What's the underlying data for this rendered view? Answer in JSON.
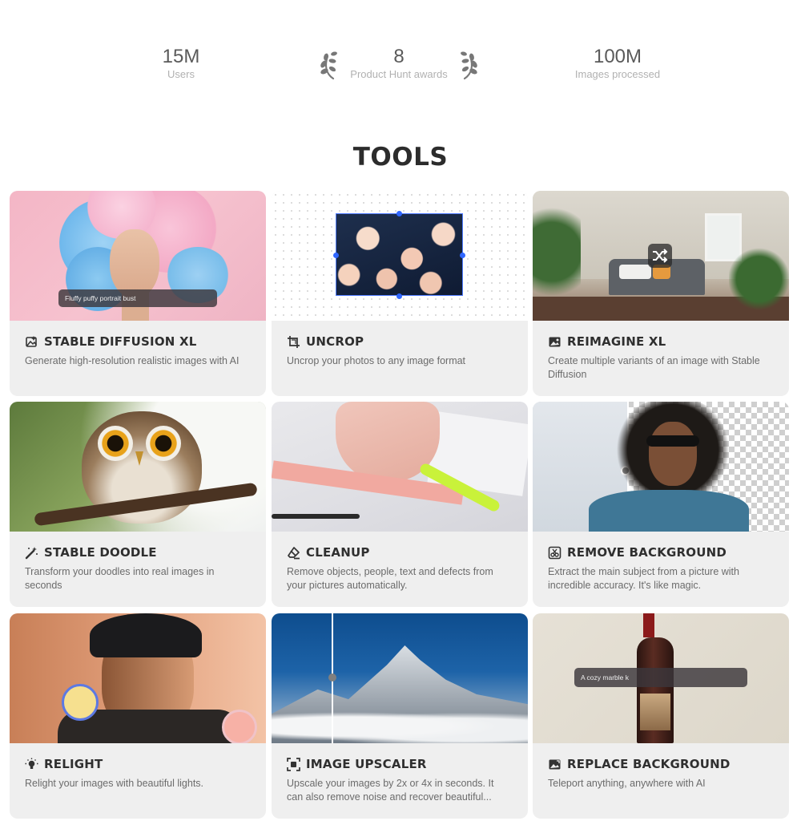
{
  "stats": {
    "users": {
      "value": "15M",
      "label": "Users"
    },
    "awards": {
      "value": "8",
      "label": "Product Hunt awards"
    },
    "images": {
      "value": "100M",
      "label": "Images processed"
    }
  },
  "section_title": "TOOLS",
  "tools": [
    {
      "title": "STABLE DIFFUSION XL",
      "desc": "Generate high-resolution realistic images with AI",
      "icon": "image-magic-icon",
      "prompt": "Fluffy puffy portrait bust"
    },
    {
      "title": "UNCROP",
      "desc": "Uncrop your photos to any image format",
      "icon": "crop-icon"
    },
    {
      "title": "REIMAGINE XL",
      "desc": "Create multiple variants of an image with Stable Diffusion",
      "icon": "image-sparkle-icon"
    },
    {
      "title": "STABLE DOODLE",
      "desc": "Transform your doodles into real images in seconds",
      "icon": "magic-wand-icon"
    },
    {
      "title": "CLEANUP",
      "desc": "Remove objects, people, text and defects from your pictures automatically.",
      "icon": "eraser-icon"
    },
    {
      "title": "REMOVE BACKGROUND",
      "desc": "Extract the main subject from a picture with incredible accuracy. It's like magic.",
      "icon": "cut-icon"
    },
    {
      "title": "RELIGHT",
      "desc": "Relight your images with beautiful lights.",
      "icon": "bulb-icon"
    },
    {
      "title": "IMAGE UPSCALER",
      "desc": "Upscale your images by 2x or 4x in seconds. It can also remove noise and recover beautiful...",
      "icon": "upscale-icon"
    },
    {
      "title": "REPLACE BACKGROUND",
      "desc": "Teleport anything, anywhere with AI",
      "icon": "image-replace-icon",
      "prompt": "A cozy marble k"
    }
  ],
  "colors": {
    "card_bg": "#efefef",
    "accent_blue": "#2f66ff",
    "title_text": "#2c2c2c"
  }
}
